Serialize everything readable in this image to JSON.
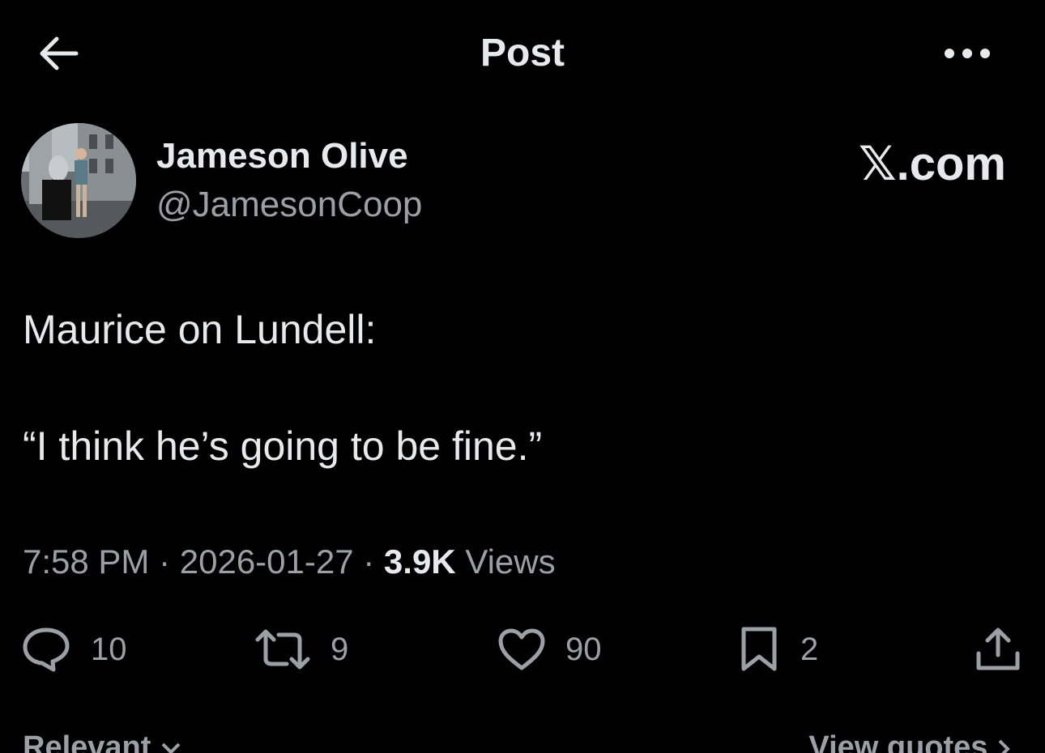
{
  "header": {
    "title": "Post",
    "back_icon": "arrow-left-icon",
    "more_icon": "more-horizontal-icon"
  },
  "author": {
    "name": "Jameson Olive",
    "handle": "@JamesonCoop",
    "avatar_description_icon": "avatar-photo"
  },
  "source": {
    "label": "𝕏.com"
  },
  "post": {
    "line1": "Maurice on Lundell:",
    "line2": "“I think he’s going to be fine.”"
  },
  "meta": {
    "time": "7:58 PM",
    "separator": " · ",
    "date": "2026-01-27",
    "views_count": "3.9K",
    "views_label": "Views"
  },
  "actions": {
    "reply_count": "10",
    "repost_count": "9",
    "like_count": "90",
    "bookmark_count": "2"
  },
  "footer": {
    "sort_label": "Relevant",
    "quotes_label": "View quotes"
  },
  "colors": {
    "background": "#000000",
    "primary_text": "#e7e9ea",
    "secondary_text": "#9aa0a6"
  }
}
